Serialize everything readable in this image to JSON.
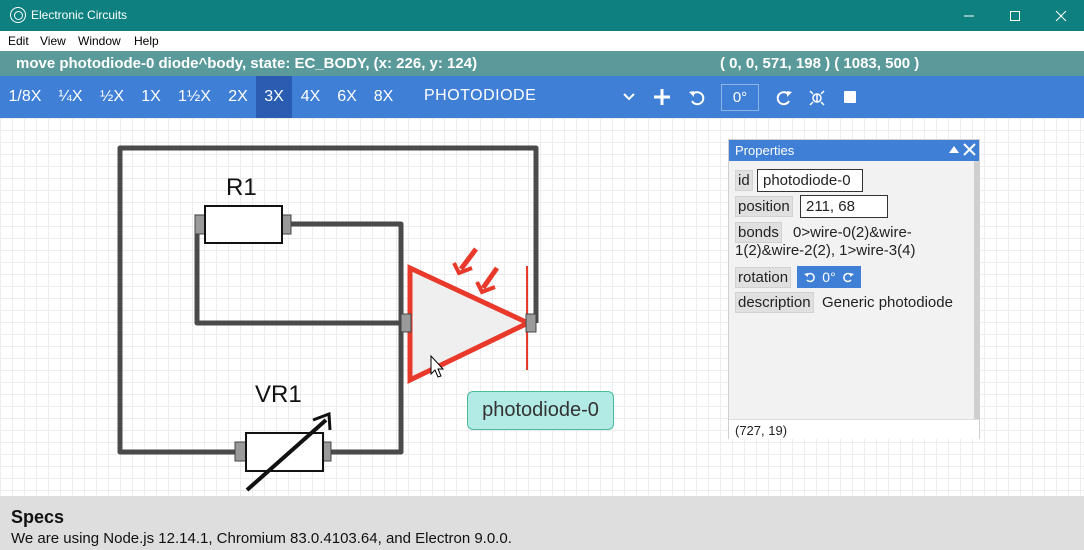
{
  "window": {
    "title": "Electronic Circuits"
  },
  "menu": [
    "Edit",
    "View",
    "Window",
    "Help"
  ],
  "status": {
    "message": "move photodiode-0 diode^body, state: EC_BODY, (x: 226, y: 124)",
    "coords": "( 0, 0, 571, 198 )  ( 1083, 500 )"
  },
  "toolbar": {
    "zooms": [
      "1/8X",
      "¼X",
      "½X",
      "1X",
      "1½X",
      "2X",
      "3X",
      "4X",
      "6X",
      "8X"
    ],
    "active_zoom": "3X",
    "part": "PHOTODIODE",
    "rotation": "0°"
  },
  "circuit": {
    "labels": {
      "r1": "R1",
      "vr1": "VR1"
    },
    "tooltip": "photodiode-0"
  },
  "properties": {
    "title": "Properties",
    "id_label": "id",
    "id_value": "photodiode-0",
    "position_label": "position",
    "position_value": "211, 68",
    "bonds_label": "bonds",
    "bonds_line1": "0>wire-0(2)&wire-",
    "bonds_line2": "1(2)&wire-2(2), 1>wire-3(4)",
    "rotation_label": "rotation",
    "rotation_value": "0°",
    "description_label": "description",
    "description_value": "Generic photodiode",
    "footer": "(727, 19)"
  },
  "specs": {
    "title": "Specs",
    "text": "We are using Node.js 12.14.1, Chromium 83.0.4103.64, and Electron 9.0.0."
  },
  "colors": {
    "titlebar": "#0e8080",
    "status": "#5b9a9a",
    "toolbar": "#3f7fd6",
    "diode": "#e8392b",
    "wire": "#4a4a4a"
  }
}
